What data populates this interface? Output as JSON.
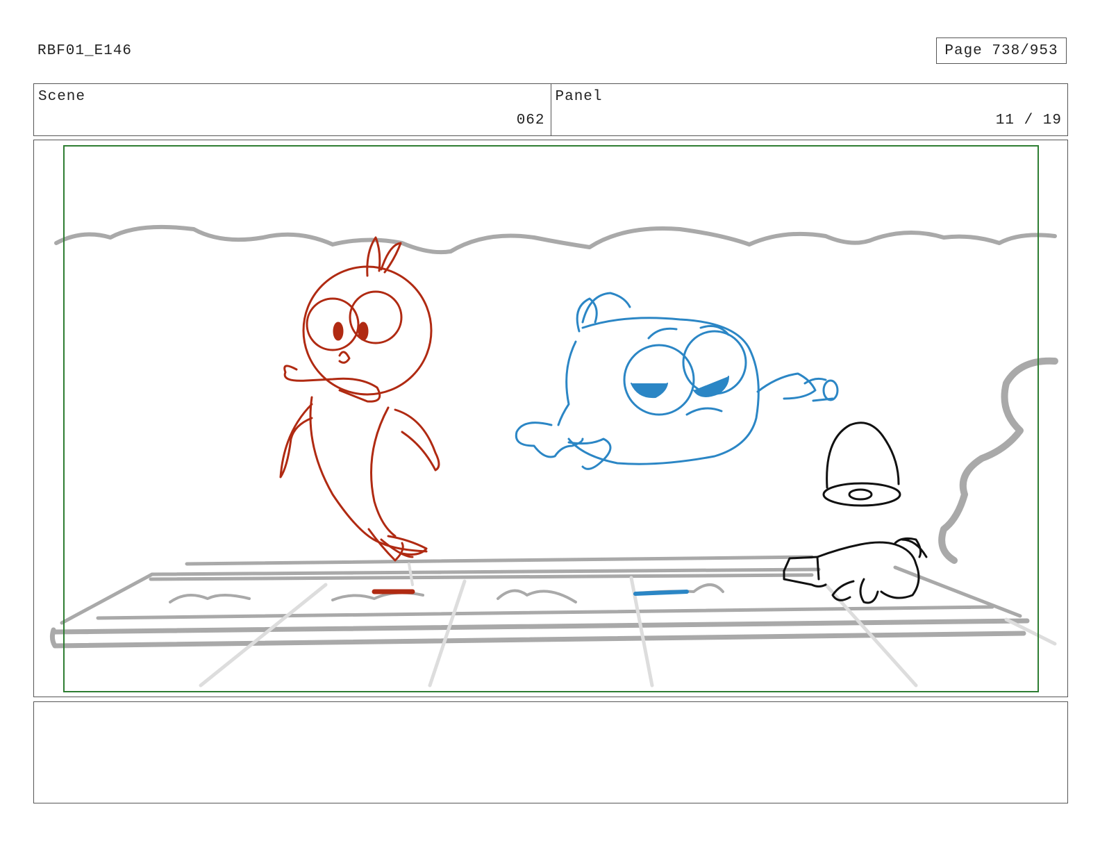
{
  "header": {
    "doc_id": "RBF01_E146",
    "page_label": "Page 738/953"
  },
  "info": {
    "scene_label": "Scene",
    "scene_value": "062",
    "panel_label": "Panel",
    "panel_value": "11 / 19"
  },
  "drawing": {
    "colors": {
      "red_character": "#b02a12",
      "blue_character": "#2b86c5",
      "black_lines": "#111111",
      "background_lines": "#a9a9a9",
      "safe_frame": "#2e7d32"
    }
  },
  "notes": {
    "text": ""
  }
}
